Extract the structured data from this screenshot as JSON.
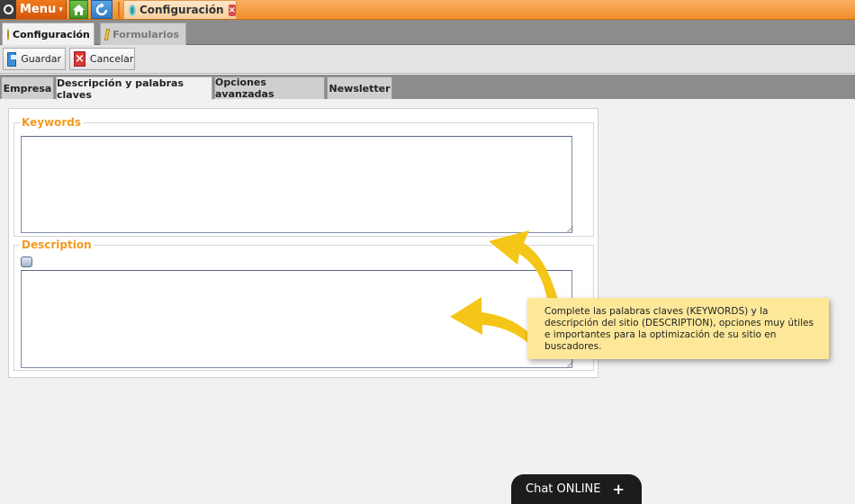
{
  "topbar": {
    "menu_label": "Menu",
    "menu_caret": "▾",
    "home_icon": "⌂",
    "refresh_icon": "↻",
    "open_tab_label": "Configuración",
    "open_tab_close": "×"
  },
  "module_tabs": {
    "active": "Configuración",
    "inactive": "Formularios"
  },
  "toolbar": {
    "save_label": "Guardar",
    "cancel_label": "Cancelar",
    "cancel_icon": "×"
  },
  "section_tabs": [
    {
      "label": "Empresa",
      "active": false
    },
    {
      "label": "Descripción y palabras claves",
      "active": true
    },
    {
      "label": "Opciones avanzadas",
      "active": false
    },
    {
      "label": "Newsletter",
      "active": false
    }
  ],
  "form": {
    "keywords_legend": "Keywords",
    "keywords_value": "",
    "description_legend": "Description",
    "description_value": ""
  },
  "callout": {
    "text": "Complete las palabras claves (KEYWORDS) y la descripción del sitio (DESCRIPTION), opciones muy útiles e importantes para la optimización de su sitio en buscadores."
  },
  "chat": {
    "label": "Chat ONLINE",
    "plus": "+"
  },
  "colors": {
    "accent_orange": "#f29a1f",
    "topbar_orange": "#ef8d2a",
    "callout_yellow": "#fde89a",
    "arrow_yellow": "#f5c518"
  },
  "icons": [
    "app-logo-icon",
    "home-icon",
    "refresh-icon",
    "gear-icon",
    "close-icon",
    "pencil-icon",
    "save-icon",
    "cancel-icon",
    "editor-icon",
    "arrow-icon",
    "plus-icon"
  ]
}
